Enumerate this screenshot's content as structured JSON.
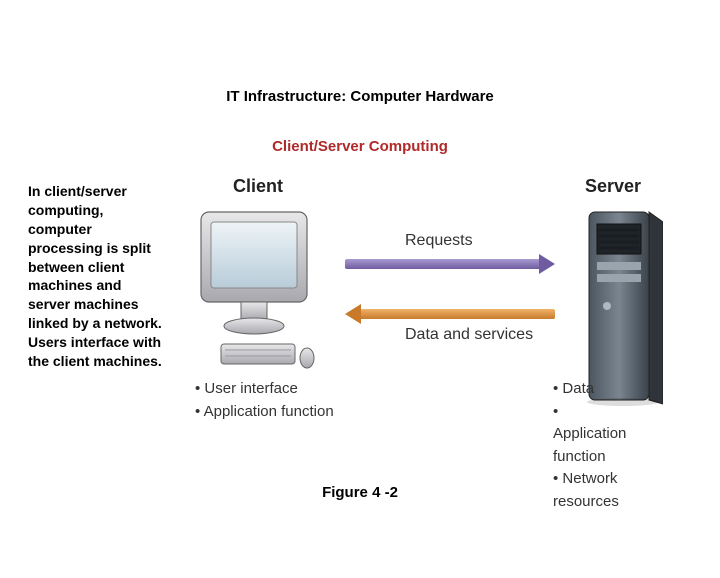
{
  "heading1": "IT Infrastructure: Computer Hardware",
  "heading2": "Client/Server Computing",
  "side_text": "In client/server computing, computer processing is split between client machines and server machines linked by a network. Users interface with the client machines.",
  "figure_caption": "Figure 4 -2",
  "diagram": {
    "client_label": "Client",
    "server_label": "Server",
    "arrow_top_label": "Requests",
    "arrow_bottom_label": "Data and services",
    "client_bullets": [
      "User interface",
      "Application function"
    ],
    "server_bullets": [
      "Data",
      "Application function",
      "Network resources"
    ]
  },
  "chart_data": {
    "type": "diagram",
    "title": "Client/Server Computing",
    "nodes": [
      {
        "id": "client",
        "label": "Client",
        "attributes": [
          "User interface",
          "Application function"
        ]
      },
      {
        "id": "server",
        "label": "Server",
        "attributes": [
          "Data",
          "Application function",
          "Network resources"
        ]
      }
    ],
    "edges": [
      {
        "from": "client",
        "to": "server",
        "label": "Requests"
      },
      {
        "from": "server",
        "to": "client",
        "label": "Data and services"
      }
    ]
  }
}
